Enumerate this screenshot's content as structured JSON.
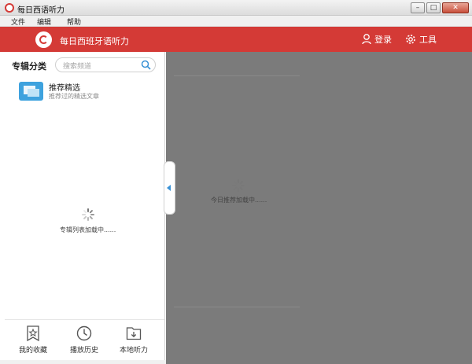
{
  "window": {
    "title": "每日西语听力",
    "buttons": [
      "minimize",
      "maximize",
      "close"
    ]
  },
  "menu": {
    "items": [
      "文件",
      "编辑",
      "帮助"
    ]
  },
  "header": {
    "app_name": "每日西班牙语听力",
    "login_label": "登录",
    "tools_label": "工具",
    "accent_color": "#d43a36"
  },
  "sidebar": {
    "heading": "专辑分类",
    "search_placeholder": "搜索频道",
    "category": {
      "title": "推荐精选",
      "subtitle": "推荐过的精选文章",
      "icon": "album-icon"
    },
    "loading_text": "专辑列表加载中......",
    "bottom_nav": [
      {
        "label": "我的收藏",
        "icon": "star-bookmark-icon"
      },
      {
        "label": "播放历史",
        "icon": "clock-icon"
      },
      {
        "label": "本地听力",
        "icon": "download-folder-icon"
      }
    ]
  },
  "main": {
    "loading_text": "今日推荐加载中......"
  }
}
